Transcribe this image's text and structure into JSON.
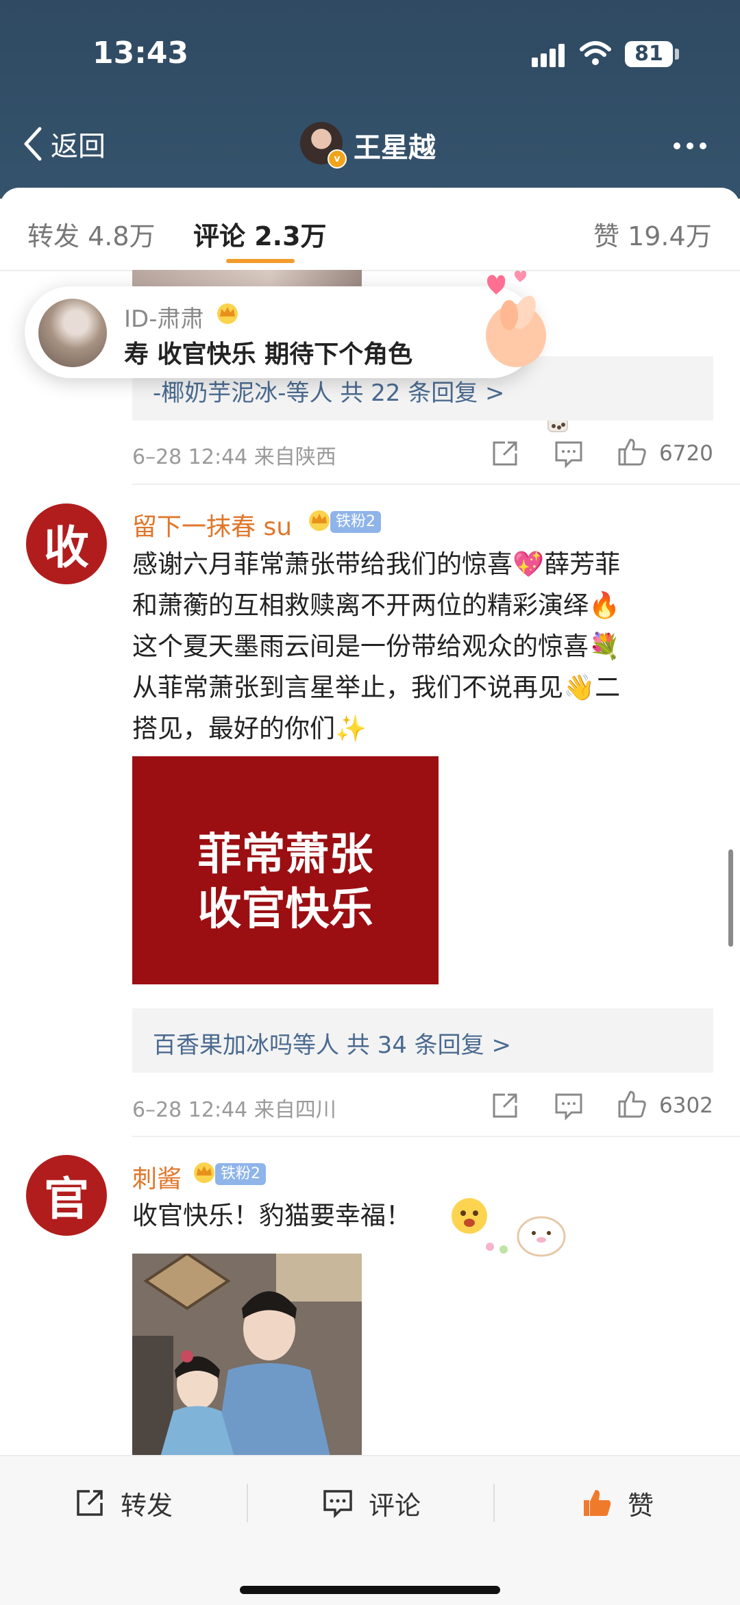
{
  "status": {
    "time": "13:43",
    "battery": "81"
  },
  "header": {
    "back_label": "返回",
    "title": "王星越"
  },
  "tabs": {
    "repost": "转发 4.8万",
    "comment": "评论 2.3万",
    "like": "赞 19.4万"
  },
  "toast": {
    "name": "ID-肃肃",
    "text": "寿 收官快乐 期待下个角色"
  },
  "comments": [
    {
      "reply_summary": "-椰奶芋泥冰-等人  共 22 条回复 >",
      "meta": "6–28 12:44  来自陕西",
      "likes": "6720"
    },
    {
      "avatar_char": "收",
      "name": "留下一抹春 su",
      "fan_badge": "铁粉2",
      "lines": [
        "感谢六月菲常萧张带给我们的惊喜💖薛芳菲",
        "和萧蘅的互相救赎离不开两位的精彩演绎🔥",
        "这个夏天墨雨云间是一份带给观众的惊喜💐",
        "从菲常萧张到言星举止，我们不说再见👋二",
        "搭见，最好的你们✨"
      ],
      "image_lines": [
        "菲常萧张",
        "收官快乐"
      ],
      "reply_summary": "百香果加冰吗等人  共 34 条回复 >",
      "meta": "6–28 12:44  来自四川",
      "likes": "6302"
    },
    {
      "avatar_char": "官",
      "name": "刺酱",
      "fan_badge": "铁粉2",
      "text": "收官快乐！豹猫要幸福！"
    }
  ],
  "bottom": {
    "repost": "转发",
    "comment": "评论",
    "like": "赞"
  },
  "colors": {
    "header_bg": "#2f4a62",
    "accent_orange": "#f39c2c",
    "username": "#e0762a",
    "link_blue": "#4a6a90",
    "avatar_red": "#b11d1d"
  }
}
